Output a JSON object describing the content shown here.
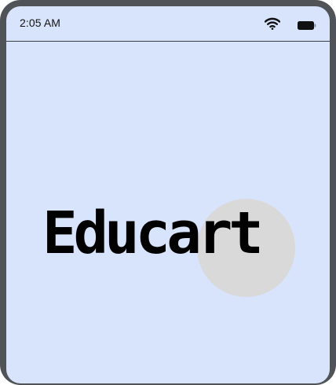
{
  "status_bar": {
    "time": "2:05 AM",
    "icons": [
      "wifi-icon",
      "battery-icon"
    ]
  },
  "splash": {
    "brand_name": "Educart"
  },
  "colors": {
    "screen_background": "#d8e3fc",
    "device_frame": "#505357",
    "accent_circle": "#d9d9d9",
    "text": "#000000"
  }
}
